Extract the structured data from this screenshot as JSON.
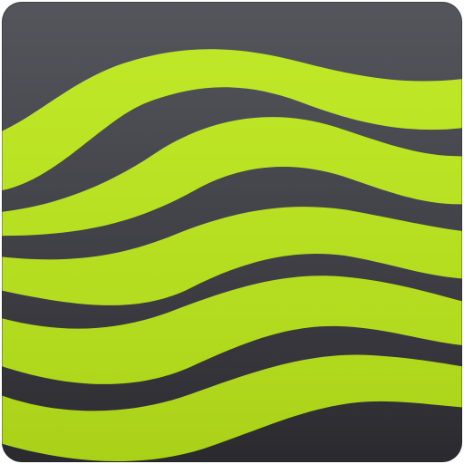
{
  "app_icon": {
    "icon_name": "waves-icon",
    "colors": {
      "background_top": "#4a4a52",
      "background_bottom": "#2e2e34",
      "wave": "#bce81a",
      "wave_highlight": "#c6ee2c",
      "edge": "#1f1f23"
    }
  }
}
